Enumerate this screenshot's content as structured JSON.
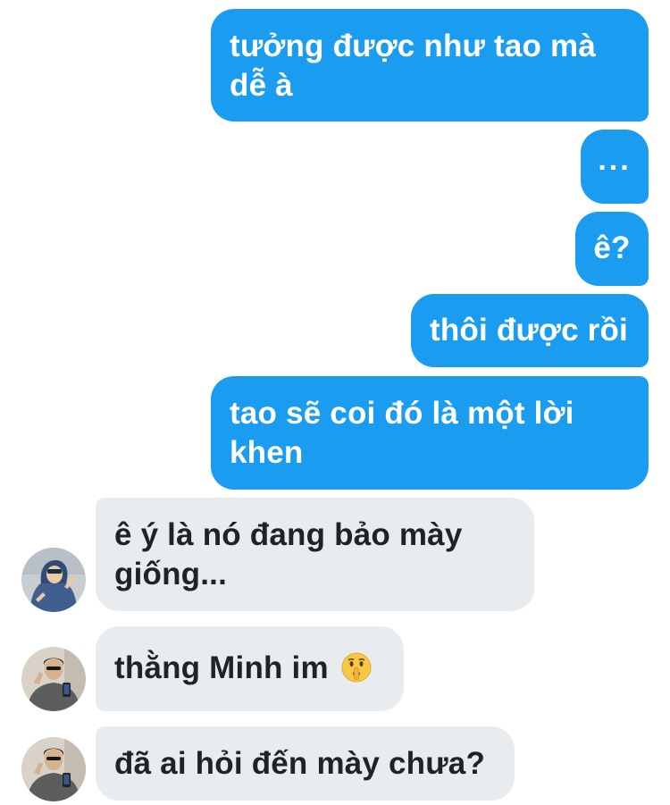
{
  "conversation": {
    "messages": [
      {
        "sender": "me",
        "lines": [
          "tưởng được như tao mà",
          "dễ à"
        ]
      },
      {
        "sender": "me",
        "text": "..."
      },
      {
        "sender": "me",
        "text": "ê?"
      },
      {
        "sender": "me",
        "text": "thôi được rồi"
      },
      {
        "sender": "me",
        "lines": [
          "tao sẽ coi đó là một lời",
          "khen"
        ]
      },
      {
        "sender": "them",
        "lines": [
          "ê ý là nó đang bảo mày",
          "giống..."
        ],
        "avatar": "avatar-blue-hoodie"
      },
      {
        "sender": "them",
        "text": "thằng Minh im",
        "emoji": "shushing-face-emoji",
        "avatar": "avatar-grey-jacket"
      },
      {
        "sender": "them",
        "text": "đã ai hỏi đến mày chưa?",
        "avatar": "avatar-grey-jacket"
      }
    ]
  },
  "colors": {
    "outgoing_bubble": "#1a9cf0",
    "outgoing_text": "#ffffff",
    "incoming_bubble": "#e9ecef",
    "incoming_text": "#1f2328",
    "background": "#ffffff"
  }
}
